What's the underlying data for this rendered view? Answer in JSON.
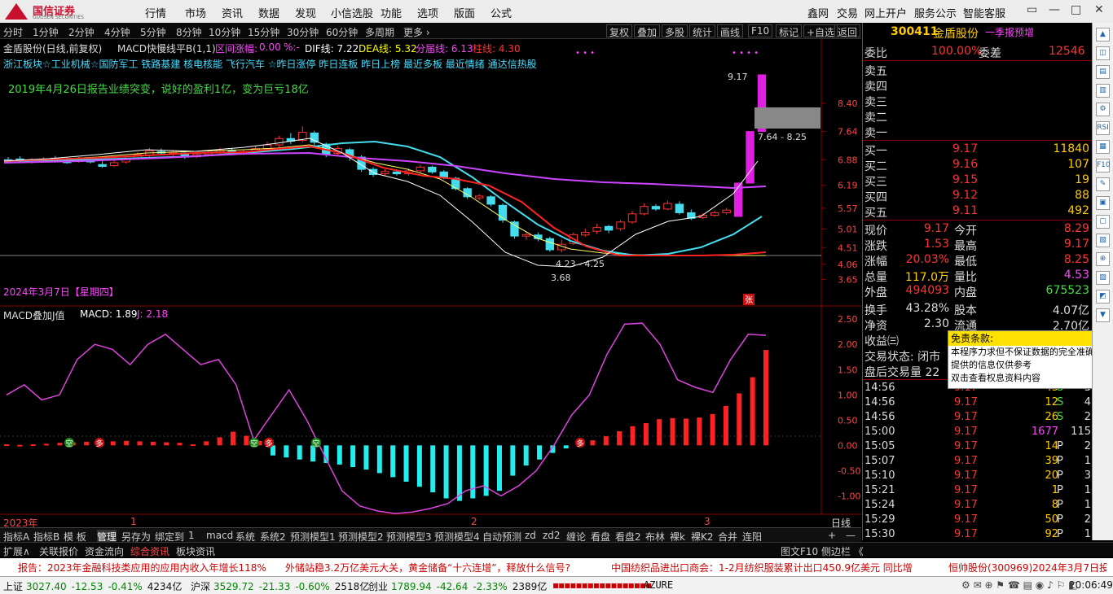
{
  "app": {
    "logo_cn": "国信证券",
    "logo_en": "GUOSEN SECURITIES"
  },
  "top_menu": [
    "行情",
    "市场",
    "资讯",
    "数据",
    "发现",
    "小信选股",
    "功能",
    "选项",
    "版面",
    "公式"
  ],
  "top_right": [
    "鑫网",
    "交易",
    "网上开户",
    "服务公示",
    "智能客服"
  ],
  "window_buttons": [
    "▭",
    "—",
    "□",
    "✕"
  ],
  "periods": [
    "分时",
    "1分钟",
    "2分钟",
    "4分钟",
    "5分钟",
    "8分钟",
    "10分钟",
    "15分钟",
    "30分钟",
    "60分钟",
    "多周期",
    "更多 ›"
  ],
  "chart_tools": [
    "复权",
    "叠加",
    "多股",
    "统计",
    "画线",
    "F10",
    "标记",
    "+自选",
    "返回"
  ],
  "main_header": {
    "name": "金盾股份(日线,前复权)",
    "indicator": "MACD快慢线平B(1,1)",
    "range_label": "区间涨幅:",
    "range_val": "0.00",
    "pct": "%:-",
    "dif": "DIF线: 7.22",
    "dea": "DEA线: 5.32",
    "fen": "分届线: 6.13",
    "zhu": "柱线: 4.30"
  },
  "tags_line": "浙江板块☆工业机械☆国防军工 铁路基建 核电核能 飞行汽车 ☆昨日涨停 昨日连板 昨日上榜 最近多板 最近情绪 通达信热股",
  "annotation": "2019年4月26日报告业绩突变，说好的盈利1亿，变为巨亏18亿",
  "date_label": "2024年3月7日【星期四】",
  "zhang_tag": "张",
  "price_labels": {
    "high": "9.17",
    "box": "7.64 - 8.25",
    "mid": "4.23 - 4.25",
    "low": "3.68"
  },
  "y_axis_main": [
    "8.40",
    "7.64",
    "6.88",
    "6.19",
    "5.57",
    "5.01",
    "4.51",
    "4.06",
    "3.65"
  ],
  "sub_header": {
    "name": "MACD叠加J值",
    "macd": "MACD: 1.89",
    "j": "J: 2.18"
  },
  "y_axis_sub": [
    "2.50",
    "2.00",
    "1.50",
    "1.00",
    "0.50",
    "0.00",
    "-0.50",
    "-1.00"
  ],
  "signal_labels": {
    "kong": "空",
    "duo": "多"
  },
  "x_axis": {
    "year": "2023年",
    "m1": "1",
    "m2": "2",
    "m3": "3",
    "period": "日线"
  },
  "chart_data": {
    "type": "candlestick",
    "candles": [
      [
        6.88,
        6.86,
        6.95,
        6.82
      ],
      [
        6.9,
        6.85,
        6.97,
        6.8
      ],
      [
        6.82,
        6.88,
        6.92,
        6.78
      ],
      [
        6.86,
        6.9,
        6.95,
        6.82
      ],
      [
        6.92,
        6.85,
        6.98,
        6.82
      ],
      [
        6.88,
        6.8,
        6.93,
        6.77
      ],
      [
        6.84,
        6.9,
        6.95,
        6.8
      ],
      [
        6.88,
        6.82,
        6.92,
        6.78
      ],
      [
        6.75,
        6.7,
        6.84,
        6.66
      ],
      [
        6.72,
        6.8,
        6.86,
        6.68
      ],
      [
        6.82,
        6.92,
        6.98,
        6.78
      ],
      [
        6.92,
        7.02,
        7.08,
        6.88
      ],
      [
        7.0,
        7.12,
        7.2,
        6.96
      ],
      [
        7.1,
        7.06,
        7.18,
        7.0
      ],
      [
        7.05,
        7.08,
        7.14,
        6.98
      ],
      [
        7.06,
        6.95,
        7.12,
        6.9
      ],
      [
        6.96,
        7.02,
        7.08,
        6.92
      ],
      [
        7.02,
        7.06,
        7.12,
        6.98
      ],
      [
        7.06,
        7.12,
        7.2,
        7.02
      ],
      [
        7.12,
        7.06,
        7.18,
        7.0
      ],
      [
        7.05,
        7.1,
        7.16,
        7.0
      ],
      [
        7.1,
        7.18,
        7.25,
        7.05
      ],
      [
        7.18,
        7.28,
        7.36,
        7.12
      ],
      [
        7.28,
        7.45,
        7.52,
        7.22
      ],
      [
        7.45,
        7.38,
        7.6,
        7.3
      ],
      [
        7.4,
        7.62,
        7.78,
        7.35
      ],
      [
        7.6,
        7.35,
        7.66,
        7.25
      ],
      [
        7.3,
        7.02,
        7.34,
        6.95
      ],
      [
        7.05,
        7.18,
        7.25,
        6.98
      ],
      [
        7.15,
        6.95,
        7.2,
        6.85
      ],
      [
        6.95,
        6.62,
        7.0,
        6.55
      ],
      [
        6.62,
        6.48,
        6.68,
        6.42
      ],
      [
        6.5,
        6.56,
        6.62,
        6.44
      ],
      [
        6.55,
        6.5,
        6.62,
        6.45
      ],
      [
        6.5,
        6.58,
        6.65,
        6.45
      ],
      [
        6.58,
        6.68,
        6.74,
        6.52
      ],
      [
        6.68,
        6.55,
        6.72,
        6.5
      ],
      [
        6.55,
        6.4,
        6.6,
        6.35
      ],
      [
        6.38,
        6.1,
        6.42,
        6.05
      ],
      [
        6.1,
        5.88,
        6.14,
        5.82
      ],
      [
        5.85,
        5.9,
        5.95,
        5.78
      ],
      [
        5.88,
        5.68,
        5.92,
        5.62
      ],
      [
        5.65,
        5.25,
        5.7,
        5.18
      ],
      [
        5.2,
        4.82,
        5.24,
        4.75
      ],
      [
        4.82,
        4.86,
        4.92,
        4.72
      ],
      [
        4.85,
        4.75,
        4.92,
        4.68
      ],
      [
        4.75,
        4.45,
        4.8,
        4.4
      ],
      [
        4.45,
        4.6,
        4.72,
        4.38
      ],
      [
        4.62,
        4.86,
        4.92,
        4.58
      ],
      [
        4.85,
        4.92,
        5.02,
        4.8
      ],
      [
        4.95,
        5.05,
        5.15,
        4.88
      ],
      [
        5.08,
        4.98,
        5.12,
        4.9
      ],
      [
        5.02,
        5.2,
        5.25,
        4.96
      ],
      [
        5.2,
        5.42,
        5.5,
        5.15
      ],
      [
        5.42,
        5.62,
        5.7,
        5.38
      ],
      [
        5.62,
        5.55,
        5.68,
        5.5
      ],
      [
        5.55,
        5.7,
        5.78,
        5.52
      ],
      [
        5.68,
        5.45,
        5.76,
        5.4
      ],
      [
        5.45,
        5.3,
        5.54,
        5.25
      ],
      [
        5.32,
        5.38,
        5.44,
        5.28
      ],
      [
        5.38,
        5.45,
        5.5,
        5.34
      ],
      [
        5.45,
        5.52,
        5.58,
        5.4
      ],
      [
        5.35,
        6.25,
        6.25,
        5.35
      ],
      [
        6.25,
        7.64,
        7.64,
        6.25
      ],
      [
        7.64,
        9.17,
        9.17,
        7.64
      ]
    ],
    "histogram": [
      0.02,
      0.01,
      0.02,
      0.03,
      0.05,
      0.06,
      0.07,
      0.08,
      0.08,
      0.09,
      0.08,
      0.07,
      0.06,
      0.05,
      0.02,
      0.08,
      0.16,
      0.27,
      0.19,
      0.09,
      -0.2,
      -0.24,
      -0.28,
      -0.32,
      -0.35,
      -0.38,
      -0.43,
      -0.48,
      -0.55,
      -0.63,
      -0.72,
      -0.82,
      -0.93,
      -1.05,
      -1.1,
      -1.05,
      -1.0,
      -0.9,
      -0.6,
      -0.4,
      -0.28,
      -0.15,
      -0.06,
      0.02,
      0.1,
      0.18,
      0.28,
      0.38,
      0.44,
      0.52,
      0.54,
      0.53,
      0.55,
      0.62,
      0.78,
      1.03,
      1.35,
      1.89
    ],
    "j_line": [
      1.0,
      1.2,
      0.9,
      1.0,
      1.7,
      2.0,
      1.9,
      1.6,
      2.0,
      2.2,
      1.9,
      1.6,
      1.7,
      1.2,
      0.1,
      0.6,
      1.1,
      0.5,
      -0.2,
      -0.9,
      -1.2,
      -1.3,
      -1.35,
      -1.32,
      -1.25,
      -1.15,
      -0.9,
      -0.8,
      -1.0,
      -0.8,
      -0.5,
      0.0,
      0.6,
      1.0,
      1.8,
      2.4,
      2.42,
      2.0,
      1.3,
      1.15,
      1.05,
      1.7,
      2.2,
      2.18
    ]
  },
  "quote": {
    "code": "300411",
    "name": "金盾股份",
    "tag": "一季报预增",
    "weibi": {
      "l": "委比",
      "v": "100.00%",
      "l2": "委差",
      "v2": "12546"
    },
    "sell": [
      "卖五",
      "卖四",
      "卖三",
      "卖二",
      "卖一"
    ],
    "buy": [
      [
        "买一",
        "9.17",
        "11840"
      ],
      [
        "买二",
        "9.16",
        "107"
      ],
      [
        "买三",
        "9.15",
        "19"
      ],
      [
        "买四",
        "9.12",
        "88"
      ],
      [
        "买五",
        "9.11",
        "492"
      ]
    ],
    "stats": [
      [
        "现价",
        "9.17",
        "今开",
        "8.29"
      ],
      [
        "涨跌",
        "1.53",
        "最高",
        "9.17"
      ],
      [
        "涨幅",
        "20.03%",
        "最低",
        "8.25"
      ],
      [
        "总量",
        "117.0万",
        "量比",
        "4.53"
      ],
      [
        "外盘",
        "494093",
        "内盘",
        "675523"
      ],
      [
        "换手",
        "43.28%",
        "股本",
        "4.07亿"
      ],
      [
        "净资",
        "2.30",
        "流通",
        "2.70亿"
      ],
      [
        "收益㈢",
        "",
        "",
        ""
      ]
    ],
    "trade_status": "交易状态: 闭市",
    "after_vol": "盘后交易量 22",
    "ticks": [
      [
        "14:56",
        "9.17",
        "45",
        "S",
        "3"
      ],
      [
        "14:56",
        "9.17",
        "12",
        "S",
        "4"
      ],
      [
        "14:56",
        "9.17",
        "26",
        "S",
        "2"
      ],
      [
        "15:00",
        "9.17",
        "1677",
        "",
        "115"
      ],
      [
        "15:05",
        "9.17",
        "14",
        "P",
        "2"
      ],
      [
        "15:07",
        "9.17",
        "39",
        "P",
        "1"
      ],
      [
        "15:10",
        "9.17",
        "20",
        "P",
        "3"
      ],
      [
        "15:21",
        "9.17",
        "1",
        "P",
        "1"
      ],
      [
        "15:24",
        "9.17",
        "8",
        "P",
        "1"
      ],
      [
        "15:29",
        "9.17",
        "50",
        "P",
        "2"
      ],
      [
        "15:30",
        "9.17",
        "92",
        "P",
        "1"
      ]
    ]
  },
  "disclaimer": {
    "title": "免责条款:",
    "lines": [
      "本程序力求但不保证数据的完全准确,",
      "提供的信息仅供参考",
      "双击查看权息资料内容"
    ]
  },
  "bottom_tabs": [
    "指标A",
    "指标B",
    "模 板",
    "管理",
    "另存为",
    "绑定到",
    "1",
    "macd",
    "系统",
    "系统2",
    "预测模型1",
    "预测模型2",
    "预测模型3",
    "预测模型4",
    "自动预测",
    "zd",
    "zd2",
    "缠论",
    "看盘",
    "看盘2",
    "布林",
    "裸k",
    "裸K2",
    "合并",
    "连阳"
  ],
  "bottom_right": [
    "+",
    "—"
  ],
  "right_tabs": [
    "笔",
    "价",
    "细",
    "势",
    "联",
    "值",
    "主",
    "筹"
  ],
  "news_tabs": [
    "扩展∧",
    "关联报价",
    "资金流向",
    "综合资讯",
    "板块资讯"
  ],
  "news_right": "图文F10 侧边栏 《",
  "ticker": [
    "报告：2023年金融科技类应用的应用内收入年增长118%",
    "外储站稳3.2万亿美元大关，黄金储备“十六连增”，释放什么信号?",
    "中国纺织品进出口商会：1-2月纺织服装累计出口450.9亿美元 同比增",
    "恒帅股份(300969)2024年3月7日投"
  ],
  "indices": [
    {
      "name": "上证",
      "val": "3027.40",
      "chg": "-12.53",
      "pct": "-0.41%",
      "amt": "4234亿"
    },
    {
      "name": "沪深",
      "val": "3529.72",
      "chg": "-21.33",
      "pct": "-0.60%",
      "amt": "2518亿"
    },
    {
      "name": "创业",
      "val": "1789.94",
      "chg": "-42.64",
      "pct": "-2.33%",
      "amt": "2389亿"
    }
  ],
  "status_extra": "AZURE",
  "clock": "20:06:49",
  "side_icons": [
    "▲",
    "◫",
    "▤",
    "▥",
    "⚙",
    "RSI",
    "▦",
    "F10",
    "✎",
    "▣",
    "▢",
    "▧",
    "⊕",
    "▨",
    "◩",
    "▼"
  ]
}
